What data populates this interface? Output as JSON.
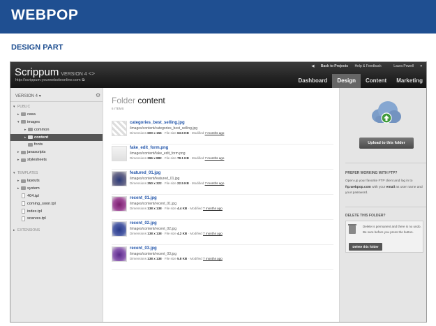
{
  "banner": {
    "title": "WEBPOP"
  },
  "subtitle": "DESIGN PART",
  "app": {
    "logo": "Scrippum",
    "version": "VERSION 4",
    "url": "http://scrippum.yourwebsiteonline.com",
    "back_link": "Back to Projects",
    "help_link": "Help & Feedback",
    "user": "Laura Powell",
    "nav": [
      {
        "label": "Dashboard"
      },
      {
        "label": "Design"
      },
      {
        "label": "Content"
      },
      {
        "label": "Marketing"
      }
    ]
  },
  "sidebar": {
    "version_select": "VERSION 4",
    "public_label": "PUBLIC",
    "casa": "casa",
    "images": "images",
    "common": "common",
    "content": "content",
    "fonts": "fonts",
    "javascripts": "javascripts",
    "stylesheets": "stylesheets",
    "templates_label": "TEMPLATES",
    "layouts": "layouts",
    "system": "system",
    "t404": "404.tpl",
    "coming_soon": "coming_soon.tpl",
    "index": "index.tpl",
    "scarves": "scarves.tpl",
    "extensions_label": "EXTENSIONS"
  },
  "folder": {
    "title_prefix": "Folder",
    "title_name": "content",
    "count": "6 ITEMS"
  },
  "files": [
    {
      "name": "categories_best_selling.jpg",
      "path": "/images/content/categories_best_selling.jpg",
      "dims": "600 x 156",
      "size": "63.6 KB",
      "modified": "7 months ago"
    },
    {
      "name": "fake_edit_form.png",
      "path": "/images/content/fake_edit_form.png",
      "dims": "396 x 882",
      "size": "78.1 KB",
      "modified": "7 months ago"
    },
    {
      "name": "featured_01.jpg",
      "path": "/images/content/featured_01.jpg",
      "dims": "350 x 322",
      "size": "22.5 KB",
      "modified": "7 months ago"
    },
    {
      "name": "recent_01.jpg",
      "path": "/images/content/recent_01.jpg",
      "dims": "138 x 138",
      "size": "4.4 KB",
      "modified": "7 months ago"
    },
    {
      "name": "recent_02.jpg",
      "path": "/images/content/recent_02.jpg",
      "dims": "138 x 138",
      "size": "4.2 KB",
      "modified": "7 months ago"
    },
    {
      "name": "recent_03.jpg",
      "path": "/images/content/recent_03.jpg",
      "dims": "138 x 138",
      "size": "5.8 KB",
      "modified": "7 months ago"
    }
  ],
  "labels": {
    "dimensions": "Dimensions",
    "file_size": "File size",
    "modified": "Modified"
  },
  "right": {
    "upload_button": "Upload to this folder",
    "ftp_heading": "PREFER WORKING WITH FTP?",
    "ftp_text_1": "Open up your favorite FTP client and log in to",
    "ftp_host": "ftp.webpop.com",
    "ftp_text_2": "with your",
    "ftp_email": "email",
    "ftp_text_3": "as user name and your password.",
    "delete_heading": "DELETE THIS FOLDER?",
    "delete_text": "Delete is permanent and there is no undo. Be sure before you press the button.",
    "delete_button": "Delete this folder"
  },
  "colors": {
    "banner": "#1f4f91",
    "link": "#2255aa",
    "topbar": "#1a1a1a"
  }
}
